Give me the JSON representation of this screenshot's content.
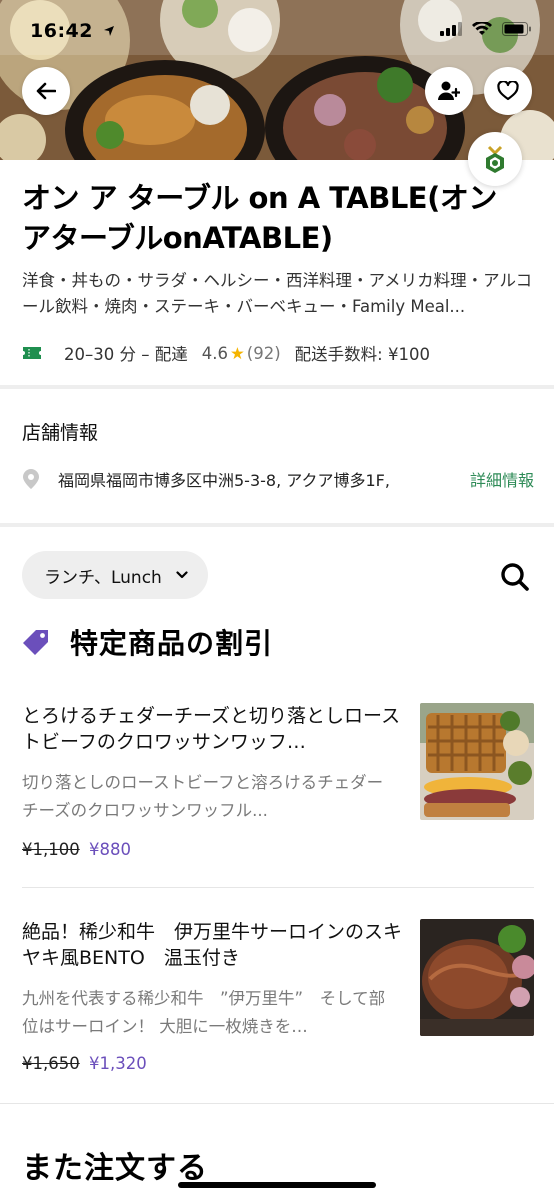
{
  "status_bar": {
    "time": "16:42"
  },
  "store": {
    "name": "オン ア ターブル on A TABLE(オンアターブルonATABLE)",
    "categories": "洋食・丼もの・サラダ・ヘルシー・西洋料理・アメリカ料理・アルコール飲料・焼肉・ステーキ・バーベキュー・Family Meal...",
    "delivery_time": "20–30 分 – 配達",
    "rating": "4.6",
    "rating_count": "(92)",
    "delivery_fee": "配送手数料: ¥100"
  },
  "store_info": {
    "title": "店舗情報",
    "address": "福岡県福岡市博多区中洲5-3-8, アクア博多1F,",
    "details_link": "詳細情報"
  },
  "menu": {
    "selected_menu": "ランチ、Lunch"
  },
  "promo_section": {
    "title": "特定商品の割引",
    "items": [
      {
        "title": "とろけるチェダーチーズと切り落としローストビーフのクロワッサンワッフ…",
        "description": "切り落としのローストビーフと溶ろけるチェダーチーズのクロワッサンワッフル...",
        "old_price": "¥1,100",
        "new_price": "¥880"
      },
      {
        "title": "絶品！稀少和牛　伊万里牛サーロインのスキヤキ風BENTO　温玉付き",
        "description": "九州を代表する稀少和牛　”伊万里牛”　そして部位はサーロイン！ 大胆に一枚焼きを…",
        "old_price": "¥1,650",
        "new_price": "¥1,320"
      }
    ]
  },
  "reorder_section": {
    "title": "また注文する"
  },
  "colors": {
    "accent_green": "#2e8b57",
    "discount_purple": "#6b4fbb",
    "promo_tag": "#6b4fbb",
    "star": "#f5b400"
  },
  "icons": {
    "back": "arrow-left-icon",
    "add_user": "add-user-icon",
    "favorite": "heart-icon",
    "location": "location-pin-icon",
    "search": "search-icon",
    "tag": "tag-icon",
    "chevron": "chevron-down-icon"
  }
}
